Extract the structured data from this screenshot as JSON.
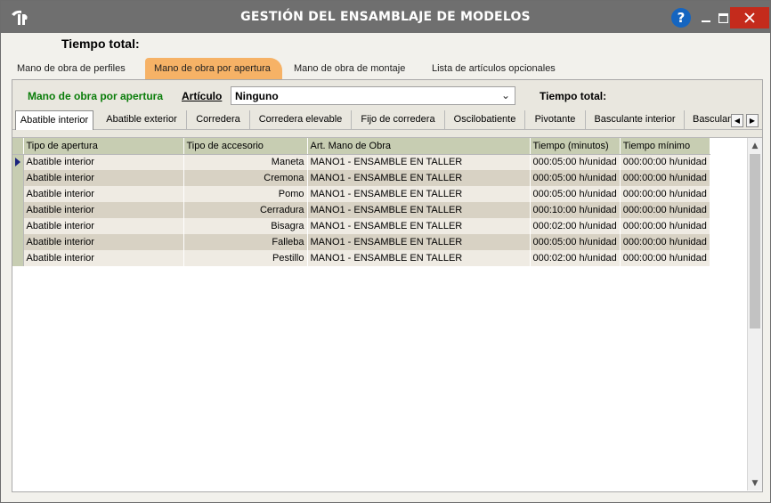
{
  "window": {
    "title": "GESTIÓN DEL ENSAMBLAJE DE MODELOS",
    "help_label": "?"
  },
  "header": {
    "total_time_label": "Tiempo total:"
  },
  "top_tabs": [
    {
      "label": "Mano de obra de perfiles",
      "active": false
    },
    {
      "label": "Mano de obra por apertura",
      "active": true
    },
    {
      "label": "Mano de obra de montaje",
      "active": false
    },
    {
      "label": "Lista de artículos opcionales",
      "active": false
    }
  ],
  "filter": {
    "section_label": "Mano de obra por apertura",
    "article_label": "Artículo",
    "article_value": "Ninguno",
    "total_time_label": "Tiempo total:"
  },
  "sub_tabs": [
    {
      "label": "Abatible interior",
      "active": true
    },
    {
      "label": "Abatible exterior",
      "active": false
    },
    {
      "label": "Corredera",
      "active": false
    },
    {
      "label": "Corredera elevable",
      "active": false
    },
    {
      "label": "Fijo de corredera",
      "active": false
    },
    {
      "label": "Oscilobatiente",
      "active": false
    },
    {
      "label": "Pivotante",
      "active": false
    },
    {
      "label": "Basculante interior",
      "active": false
    },
    {
      "label": "Basculan",
      "active": false
    }
  ],
  "grid": {
    "columns": [
      "Tipo de apertura",
      "Tipo de accesorio",
      "Art. Mano de Obra",
      "Tiempo (minutos)",
      "Tiempo mínimo"
    ],
    "rows": [
      [
        "Abatible interior",
        "Maneta",
        "MANO1 - ENSAMBLE EN TALLER",
        "000:05:00 h/unidad",
        "000:00:00 h/unidad"
      ],
      [
        "Abatible interior",
        "Cremona",
        "MANO1 - ENSAMBLE EN TALLER",
        "000:05:00 h/unidad",
        "000:00:00 h/unidad"
      ],
      [
        "Abatible interior",
        "Pomo",
        "MANO1 - ENSAMBLE EN TALLER",
        "000:05:00 h/unidad",
        "000:00:00 h/unidad"
      ],
      [
        "Abatible interior",
        "Cerradura",
        "MANO1 - ENSAMBLE EN TALLER",
        "000:10:00 h/unidad",
        "000:00:00 h/unidad"
      ],
      [
        "Abatible interior",
        "Bisagra",
        "MANO1 - ENSAMBLE EN TALLER",
        "000:02:00 h/unidad",
        "000:00:00 h/unidad"
      ],
      [
        "Abatible interior",
        "Falleba",
        "MANO1 - ENSAMBLE EN TALLER",
        "000:05:00 h/unidad",
        "000:00:00 h/unidad"
      ],
      [
        "Abatible interior",
        "Pestillo",
        "MANO1 - ENSAMBLE EN TALLER",
        "000:02:00 h/unidad",
        "000:00:00 h/unidad"
      ]
    ]
  }
}
